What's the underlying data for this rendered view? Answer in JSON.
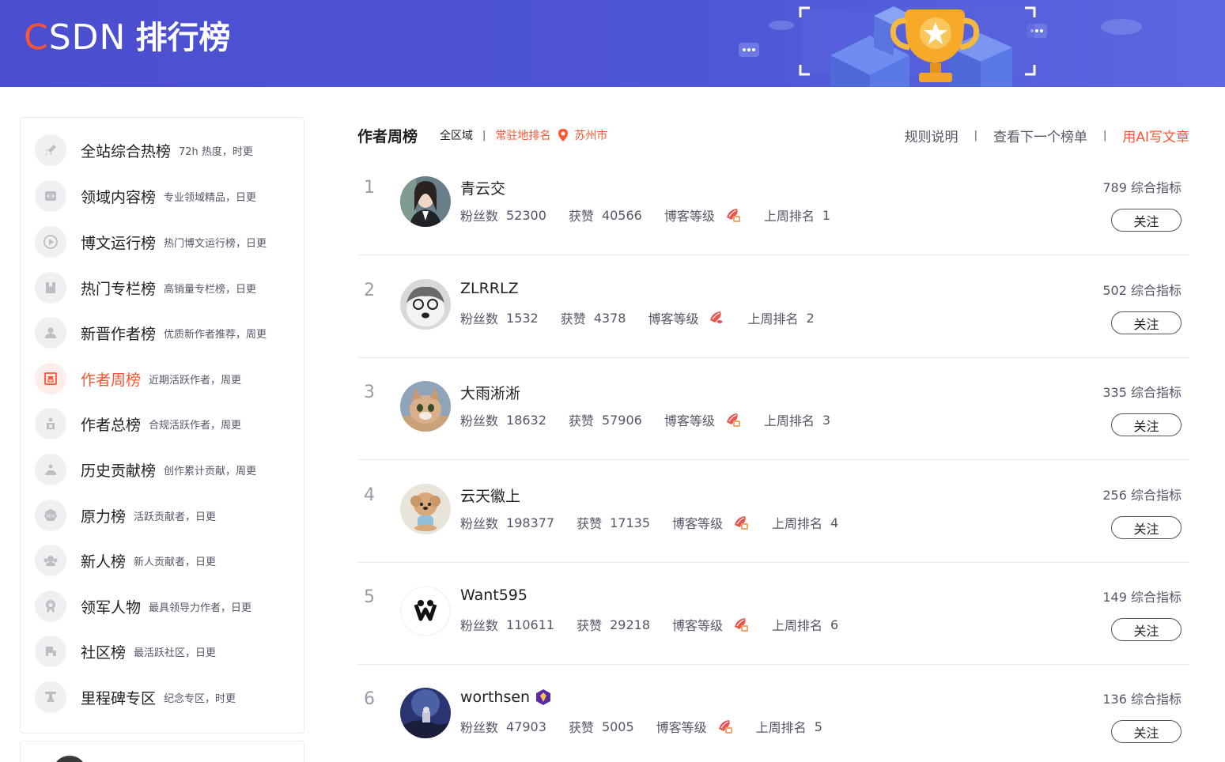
{
  "header": {
    "logo_text": "CSDN",
    "logo_first": "C",
    "logo_rest": "SDN",
    "title": "排行榜"
  },
  "sidebar": {
    "items": [
      {
        "label": "全站综合热榜",
        "desc": "72h 热度，时更",
        "icon": "rocket-icon",
        "active": false
      },
      {
        "label": "领域内容榜",
        "desc": "专业领域精品，日更",
        "icon": "code-icon",
        "active": false
      },
      {
        "label": "博文运行榜",
        "desc": "热门博文运行榜，日更",
        "icon": "play-icon",
        "active": false
      },
      {
        "label": "热门专栏榜",
        "desc": "高销量专栏榜，日更",
        "icon": "book-icon",
        "active": false
      },
      {
        "label": "新晋作者榜",
        "desc": "优质新作者推荐，周更",
        "icon": "user-icon",
        "active": false
      },
      {
        "label": "作者周榜",
        "desc": "近期活跃作者，周更",
        "icon": "calendar-icon",
        "active": true
      },
      {
        "label": "作者总榜",
        "desc": "合规活跃作者，周更",
        "icon": "group-icon",
        "active": false
      },
      {
        "label": "历史贡献榜",
        "desc": "创作累计贡献，周更",
        "icon": "hand-icon",
        "active": false
      },
      {
        "label": "原力榜",
        "desc": "活跃贡献者，日更",
        "icon": "force-icon",
        "active": false
      },
      {
        "label": "新人榜",
        "desc": "新人贡献者，日更",
        "icon": "newcomer-icon",
        "active": false
      },
      {
        "label": "领军人物",
        "desc": "最具领导力作者，日更",
        "icon": "medal-icon",
        "active": false
      },
      {
        "label": "社区榜",
        "desc": "最活跃社区，日更",
        "icon": "community-icon",
        "active": false
      },
      {
        "label": "里程碑专区",
        "desc": "纪念专区，时更",
        "icon": "milestone-icon",
        "active": false
      }
    ]
  },
  "main": {
    "tab_title": "作者周榜",
    "region_all": "全区域",
    "sep": "|",
    "region_local": "常驻地排名",
    "city": "苏州市",
    "links": {
      "rules": "规则说明",
      "next": "查看下一个榜单",
      "ai": "用AI写文章"
    },
    "labels": {
      "fans": "粉丝数",
      "likes": "获赞",
      "level": "博客等级",
      "last_rank": "上周排名",
      "score_suffix": "综合指标",
      "follow": "关注"
    },
    "rows": [
      {
        "rank": "1",
        "name": "青云交",
        "fans": "52300",
        "likes": "40566",
        "last_rank": "1",
        "score": "789 综合指标"
      },
      {
        "rank": "2",
        "name": "ZLRRLZ",
        "fans": "1532",
        "likes": "4378",
        "last_rank": "2",
        "score": "502 综合指标"
      },
      {
        "rank": "3",
        "name": "大雨淅淅",
        "fans": "18632",
        "likes": "57906",
        "last_rank": "3",
        "score": "335 综合指标"
      },
      {
        "rank": "4",
        "name": "云天徽上",
        "fans": "198377",
        "likes": "17135",
        "last_rank": "4",
        "score": "256 综合指标"
      },
      {
        "rank": "5",
        "name": "Want595",
        "fans": "110611",
        "likes": "29218",
        "last_rank": "6",
        "score": "149 综合指标"
      },
      {
        "rank": "6",
        "name": "worthsen",
        "fans": "47903",
        "likes": "5005",
        "last_rank": "5",
        "score": "136 综合指标"
      }
    ]
  },
  "colors": {
    "header_bg": "#4b4fcf",
    "accent": "#fc5531",
    "text": "#222226",
    "muted": "#555666"
  }
}
